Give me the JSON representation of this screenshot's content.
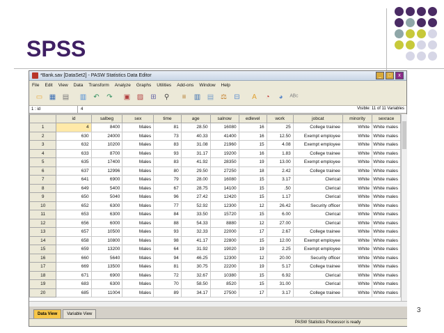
{
  "slide": {
    "title": "SPSS",
    "page_number": "3",
    "dot_colors": [
      "#4a2b64",
      "#8fa7a8",
      "#c7c93a",
      "#d6d6e6"
    ]
  },
  "window": {
    "title": "*Bank.sav [DataSet2] - PASW Statistics Data Editor",
    "controls": {
      "minimize": "_",
      "maximize": "□",
      "close": "x"
    }
  },
  "menu": [
    "File",
    "Edit",
    "View",
    "Data",
    "Transform",
    "Analyze",
    "Graphs",
    "Utilities",
    "Add-ons",
    "Window",
    "Help"
  ],
  "toolbar_icons": [
    "open-icon",
    "save-icon",
    "print-icon",
    "dialog-recall-icon",
    "undo-icon",
    "redo-icon",
    "goto-case-icon",
    "goto-variable-icon",
    "variables-icon",
    "find-icon",
    "insert-cases-icon",
    "insert-variable-icon",
    "split-file-icon",
    "weight-cases-icon",
    "select-cases-icon",
    "value-labels-icon",
    "use-sets-icon",
    "show-all-icon",
    "spell-check-icon"
  ],
  "cellbar": {
    "ref": "1 : id",
    "value": "4",
    "visible": "Visible: 11 of 11 Variables"
  },
  "grid": {
    "columns": [
      "id",
      "salbeg",
      "sex",
      "time",
      "age",
      "salnow",
      "edlevel",
      "work",
      "jobcat",
      "minority",
      "sexrace"
    ],
    "rows": [
      [
        "1",
        "4",
        "8400",
        "Males",
        "81",
        "28.50",
        "16080",
        "16",
        "25",
        "College trainee",
        "White",
        "White males"
      ],
      [
        "2",
        "630",
        "24000",
        "Males",
        "73",
        "40.33",
        "41400",
        "16",
        "12.50",
        "Exempt employee",
        "White",
        "White males"
      ],
      [
        "3",
        "632",
        "10200",
        "Males",
        "83",
        "31.08",
        "21960",
        "15",
        "4.08",
        "Exempt employee",
        "White",
        "White males"
      ],
      [
        "4",
        "633",
        "8700",
        "Males",
        "93",
        "31.17",
        "19200",
        "16",
        "1.83",
        "College trainee",
        "White",
        "White males"
      ],
      [
        "5",
        "635",
        "17400",
        "Males",
        "83",
        "41.92",
        "28350",
        "19",
        "13.00",
        "Exempt employee",
        "White",
        "White males"
      ],
      [
        "6",
        "637",
        "12996",
        "Males",
        "80",
        "29.50",
        "27250",
        "18",
        "2.42",
        "College trainee",
        "White",
        "White males"
      ],
      [
        "7",
        "641",
        "6900",
        "Males",
        "79",
        "28.00",
        "16080",
        "15",
        "3.17",
        "Clerical",
        "White",
        "White males"
      ],
      [
        "8",
        "649",
        "5400",
        "Males",
        "67",
        "28.75",
        "14100",
        "15",
        ".50",
        "Clerical",
        "White",
        "White males"
      ],
      [
        "9",
        "650",
        "5040",
        "Males",
        "96",
        "27.42",
        "12420",
        "15",
        "1.17",
        "Clerical",
        "White",
        "White males"
      ],
      [
        "10",
        "652",
        "6300",
        "Males",
        "77",
        "52.92",
        "12300",
        "12",
        "26.42",
        "Security officer",
        "White",
        "White males"
      ],
      [
        "11",
        "653",
        "6300",
        "Males",
        "84",
        "33.50",
        "15720",
        "15",
        "6.00",
        "Clerical",
        "White",
        "White males"
      ],
      [
        "12",
        "656",
        "6000",
        "Males",
        "88",
        "54.33",
        "8880",
        "12",
        "27.00",
        "Clerical",
        "White",
        "White males"
      ],
      [
        "13",
        "657",
        "10500",
        "Males",
        "93",
        "32.33",
        "22000",
        "17",
        "2.67",
        "College trainee",
        "White",
        "White males"
      ],
      [
        "14",
        "658",
        "10800",
        "Males",
        "98",
        "41.17",
        "22800",
        "15",
        "12.00",
        "Exempt employee",
        "White",
        "White males"
      ],
      [
        "15",
        "659",
        "13200",
        "Males",
        "64",
        "31.92",
        "19020",
        "19",
        "2.25",
        "Exempt employee",
        "White",
        "White males"
      ],
      [
        "16",
        "660",
        "5640",
        "Males",
        "94",
        "46.25",
        "12300",
        "12",
        "20.00",
        "Security officer",
        "White",
        "White males"
      ],
      [
        "17",
        "669",
        "13500",
        "Males",
        "81",
        "30.75",
        "22200",
        "19",
        "5.17",
        "College trainee",
        "White",
        "White males"
      ],
      [
        "18",
        "671",
        "6900",
        "Males",
        "72",
        "32.67",
        "10380",
        "15",
        "6.92",
        "Clerical",
        "White",
        "White males"
      ],
      [
        "19",
        "683",
        "6300",
        "Males",
        "70",
        "58.50",
        "8520",
        "15",
        "31.00",
        "Clerical",
        "White",
        "White males"
      ],
      [
        "20",
        "685",
        "11004",
        "Males",
        "89",
        "34.17",
        "27500",
        "17",
        "3.17",
        "College trainee",
        "White",
        "White males"
      ]
    ]
  },
  "tabs": [
    "Data View",
    "Variable View"
  ],
  "active_tab": "Data View",
  "status": "PASW Statistics Processor is ready"
}
